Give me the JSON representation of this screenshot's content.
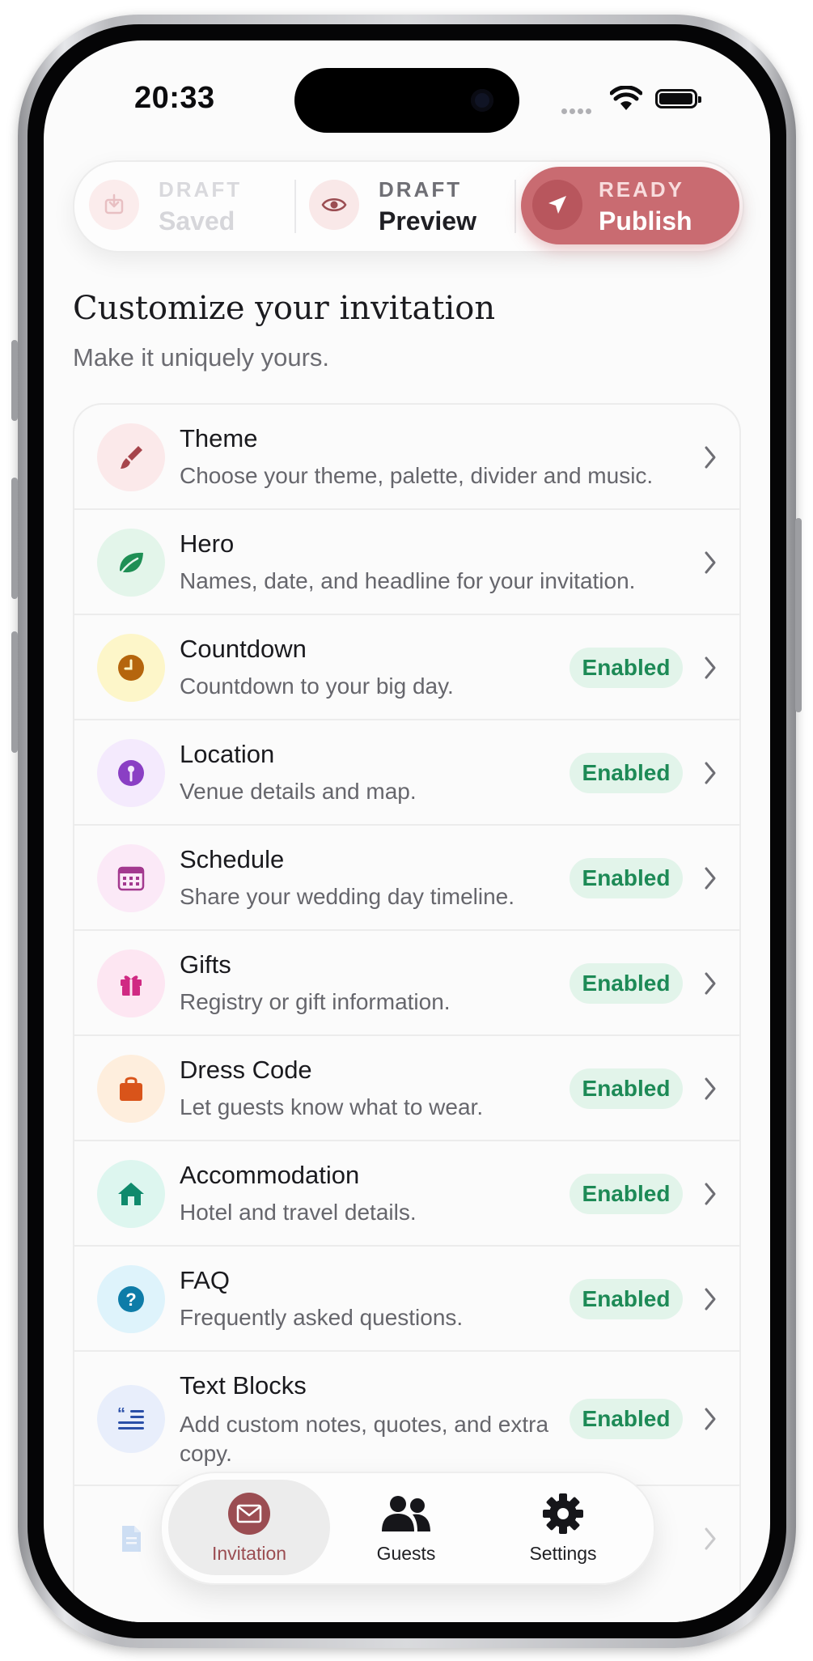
{
  "status_bar": {
    "time": "20:33"
  },
  "stepper": {
    "steps": [
      {
        "status": "DRAFT",
        "label": "Saved"
      },
      {
        "status": "DRAFT",
        "label": "Preview"
      },
      {
        "status": "READY",
        "label": "Publish"
      }
    ]
  },
  "header": {
    "title": "Customize your invitation",
    "subtitle": "Make it uniquely yours."
  },
  "sections": [
    {
      "title": "Theme",
      "description": "Choose your theme, palette, divider and music.",
      "badge": "",
      "icon": "paintbrush-icon",
      "color": "#a6444b",
      "bg": "#fbe9ea"
    },
    {
      "title": "Hero",
      "description": "Names, date, and headline for your invitation.",
      "badge": "",
      "icon": "leaf-icon",
      "color": "#1f8f55",
      "bg": "#e3f5ea"
    },
    {
      "title": "Countdown",
      "description": "Countdown to your big day.",
      "badge": "Enabled",
      "icon": "clock-icon",
      "color": "#b5650d",
      "bg": "#fdf6c9"
    },
    {
      "title": "Location",
      "description": "Venue details and map.",
      "badge": "Enabled",
      "icon": "map-pin-icon",
      "color": "#8a3fc4",
      "bg": "#f4eafd"
    },
    {
      "title": "Schedule",
      "description": "Share your wedding day timeline.",
      "badge": "Enabled",
      "icon": "calendar-icon",
      "color": "#a3398f",
      "bg": "#fbe9f7"
    },
    {
      "title": "Gifts",
      "description": "Registry or gift information.",
      "badge": "Enabled",
      "icon": "gift-icon",
      "color": "#d02a83",
      "bg": "#fde6f2"
    },
    {
      "title": "Dress Code",
      "description": "Let guests know what to wear.",
      "badge": "Enabled",
      "icon": "shopping-bag-icon",
      "color": "#d9541a",
      "bg": "#feeedd"
    },
    {
      "title": "Accommodation",
      "description": "Hotel and travel details.",
      "badge": "Enabled",
      "icon": "home-icon",
      "color": "#0f8a6c",
      "bg": "#ddf6ef"
    },
    {
      "title": "FAQ",
      "description": "Frequently asked questions.",
      "badge": "Enabled",
      "icon": "question-icon",
      "color": "#0e7ca8",
      "bg": "#def3fb"
    },
    {
      "title": "Text Blocks",
      "description": "Add custom notes, quotes, and extra copy.",
      "badge": "Enabled",
      "icon": "quote-text-icon",
      "color": "#2a4fa8",
      "bg": "#e8eefb"
    }
  ],
  "tabbar": {
    "tabs": [
      {
        "label": "Invitation",
        "active": true
      },
      {
        "label": "Guests",
        "active": false
      },
      {
        "label": "Settings",
        "active": false
      }
    ]
  },
  "colors": {
    "accent": "#c96b71",
    "enabled_badge_bg": "#e2f4ea",
    "enabled_badge_text": "#1d8a56"
  }
}
